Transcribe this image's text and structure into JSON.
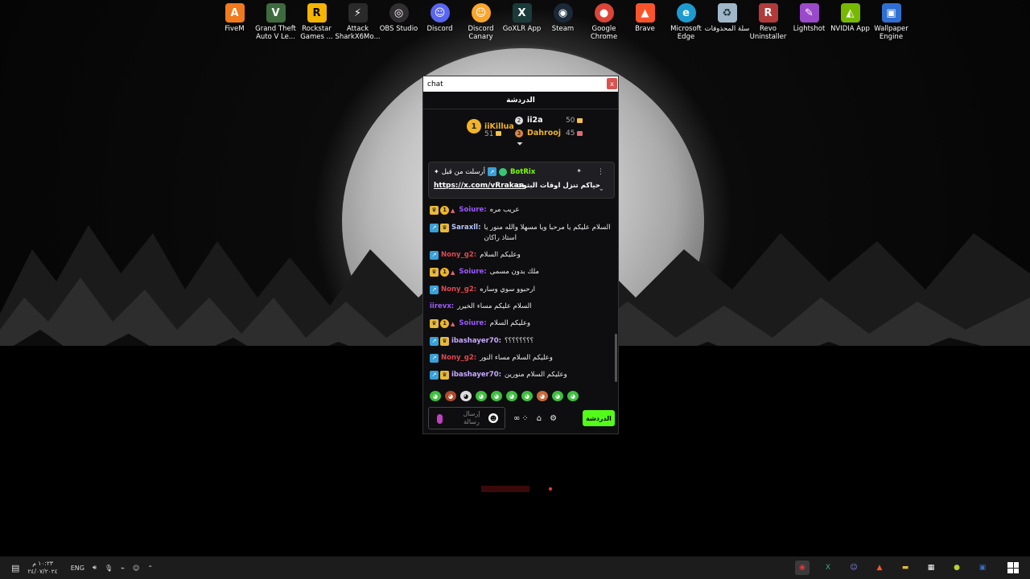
{
  "desktop": {
    "icons": [
      {
        "label": "FiveM",
        "icon": "fivem-icon",
        "color": "#f07a1d",
        "glyph": "A"
      },
      {
        "label": "Grand Theft Auto V Le...",
        "icon": "gta-icon",
        "color": "#3e6b3e",
        "glyph": "V"
      },
      {
        "label": "Rockstar Games ...",
        "icon": "rockstar-icon",
        "color": "#f4b400",
        "glyph": "R"
      },
      {
        "label": "Attack SharkX6Mo...",
        "icon": "shark-mouse-icon",
        "color": "#2a2a2a",
        "glyph": "⚡"
      },
      {
        "label": "OBS Studio",
        "icon": "obs-icon",
        "color": "#302e31",
        "glyph": "◎"
      },
      {
        "label": "Discord",
        "icon": "discord-icon",
        "color": "#5865f2",
        "glyph": "☺"
      },
      {
        "label": "Discord Canary",
        "icon": "discord-canary-icon",
        "color": "#f9a62b",
        "glyph": "☺"
      },
      {
        "label": "GoXLR App",
        "icon": "goxlr-icon",
        "color": "#1b3b3b",
        "glyph": "X"
      },
      {
        "label": "Steam",
        "icon": "steam-icon",
        "color": "#1b2838",
        "glyph": "◉"
      },
      {
        "label": "Google Chrome",
        "icon": "chrome-icon",
        "color": "#db4437",
        "glyph": "●"
      },
      {
        "label": "Brave",
        "icon": "brave-icon",
        "color": "#fb542b",
        "glyph": "▲"
      },
      {
        "label": "Microsoft Edge",
        "icon": "edge-icon",
        "color": "#1d9bd1",
        "glyph": "e"
      },
      {
        "label": "سلة المحذوفات",
        "icon": "recycle-bin-icon",
        "color": "#9fb7c9",
        "glyph": "♻"
      },
      {
        "label": "Revo Uninstaller",
        "icon": "revo-icon",
        "color": "#b23a3a",
        "glyph": "R"
      },
      {
        "label": "Lightshot",
        "icon": "lightshot-icon",
        "color": "#9a49c9",
        "glyph": "✎"
      },
      {
        "label": "NVIDIA App",
        "icon": "nvidia-icon",
        "color": "#76b900",
        "glyph": "◭"
      },
      {
        "label": "Wallpaper Engine",
        "icon": "wallpaper-engine-icon",
        "color": "#2f6fd1",
        "glyph": "▣"
      }
    ]
  },
  "chat_window": {
    "title": "chat",
    "close_label": "x",
    "header": "الدردشة",
    "leaderboard": {
      "first": {
        "rank": "1",
        "name": "iiKillua",
        "points": "51"
      },
      "second": {
        "name": "ii2a",
        "points": "50"
      },
      "third": {
        "name": "Dahrooj",
        "points": "45"
      }
    },
    "pinned": {
      "label": "أرسلت من قبل",
      "sender": "BotRix",
      "link": "https://x.com/vRrakan",
      "text": "حياكم تنزل اوقات البثوث"
    },
    "messages": [
      {
        "user": "Soiure:",
        "color": "#9b59ff",
        "text": "عريب مره",
        "badges": [
          "crown",
          "one",
          "hat"
        ]
      },
      {
        "user": "Saraxll:",
        "color": "#b7c7ff",
        "text": "السلام عليكم يا مرحبا ويا مسهلا والله منور يا استاذ راكان",
        "badges": [
          "sq",
          "crown"
        ]
      },
      {
        "user": "Nony_g2:",
        "color": "#e0484f",
        "text": "وعليكم السلام",
        "badges": [
          "sq"
        ]
      },
      {
        "user": "Soiure:",
        "color": "#9b59ff",
        "text": "ملك بدون مسمى",
        "badges": [
          "crown",
          "one",
          "hat"
        ]
      },
      {
        "user": "Nony_g2:",
        "color": "#e0484f",
        "text": "ارحبوو سوي وساره",
        "badges": [
          "sq"
        ]
      },
      {
        "user": "iirevx:",
        "color": "#a259ff",
        "text": "السلام عليكم مساء الخيرر",
        "badges": []
      },
      {
        "user": "Soiure:",
        "color": "#9b59ff",
        "text": "وعليكم السلام",
        "badges": [
          "crown",
          "one",
          "hat"
        ]
      },
      {
        "user": "ibashayer70:",
        "color": "#c8a8ff",
        "text": "؟؟؟؟؟؟؟؟",
        "badges": [
          "sq",
          "crown"
        ]
      },
      {
        "user": "Nony_g2:",
        "color": "#e0484f",
        "text": "وعليكم السلام مساء النور",
        "badges": [
          "sq"
        ]
      },
      {
        "user": "ibashayer70:",
        "color": "#c8a8ff",
        "text": "وعليكم السلام منورين",
        "badges": [
          "sq",
          "crown"
        ]
      }
    ],
    "input": {
      "placeholder": "إرسال رسالة"
    },
    "send_label": "الدردشة",
    "colors": {
      "accent": "#53fc18",
      "gold": "#f0b429"
    }
  },
  "taskbar": {
    "language": "ENG",
    "time": "١٠:٢٣ م",
    "date": "٢٤/٠٧/٢٠٢٤"
  }
}
